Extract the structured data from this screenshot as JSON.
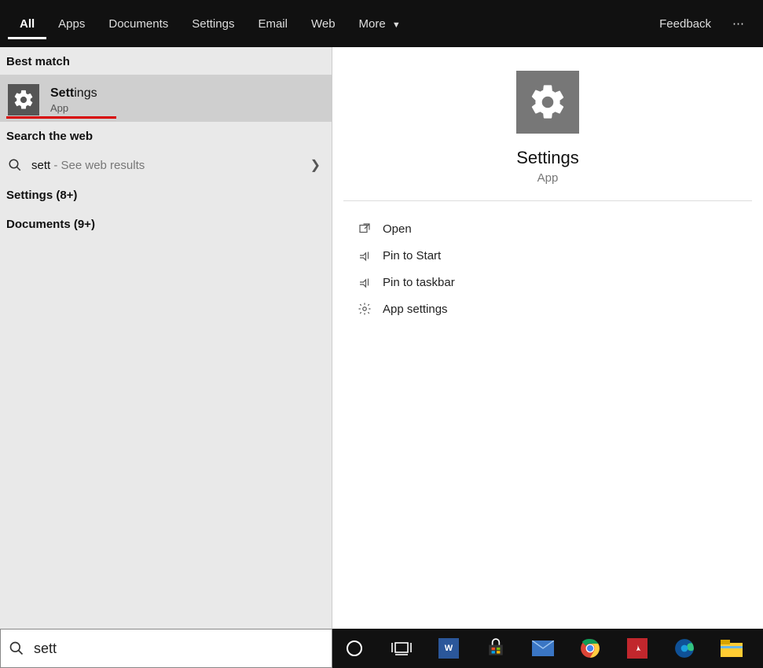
{
  "topbar": {
    "tabs": [
      "All",
      "Apps",
      "Documents",
      "Settings",
      "Email",
      "Web",
      "More"
    ],
    "active_index": 0,
    "feedback": "Feedback",
    "ellipsis": "⋯"
  },
  "left": {
    "best_match_label": "Best match",
    "best_match": {
      "title_bold": "Sett",
      "title_rest": "ings",
      "subtitle": "App"
    },
    "search_web_label": "Search the web",
    "web_result": {
      "query": "sett",
      "hint": " - See web results"
    },
    "groups": [
      "Settings (8+)",
      "Documents (9+)"
    ]
  },
  "preview": {
    "title": "Settings",
    "subtitle": "App",
    "actions": [
      "Open",
      "Pin to Start",
      "Pin to taskbar",
      "App settings"
    ]
  },
  "search": {
    "value": "sett"
  },
  "taskbar_icons": [
    "cortana",
    "task-view",
    "word",
    "store",
    "mail",
    "chrome",
    "acrobat",
    "edge",
    "explorer"
  ]
}
